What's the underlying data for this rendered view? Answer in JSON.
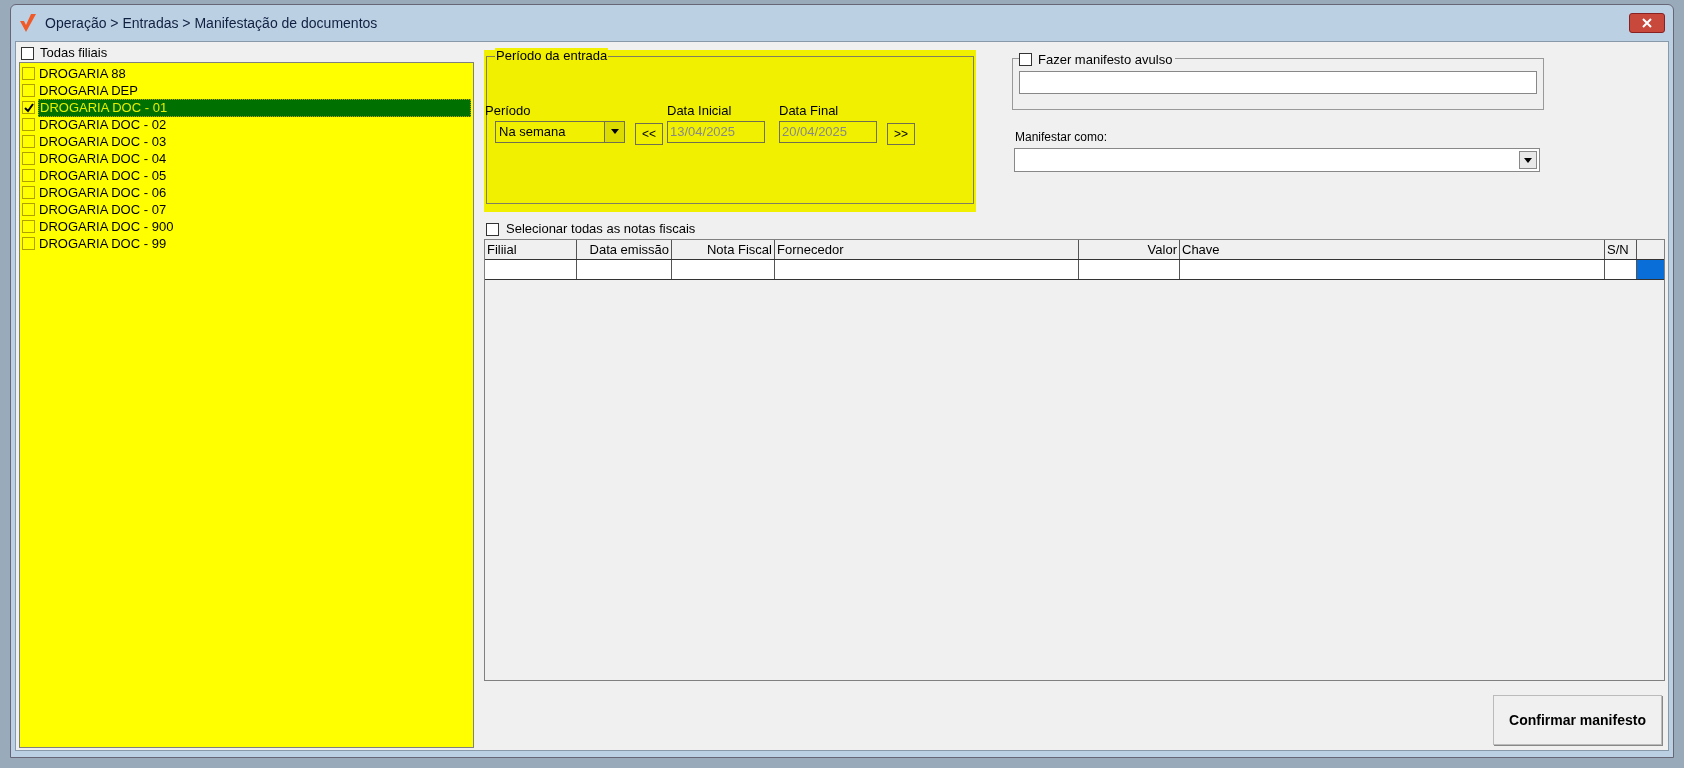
{
  "window": {
    "title": "Operação > Entradas > Manifestação de documentos"
  },
  "branches": {
    "all": {
      "label": "Todas filiais",
      "checked": false
    },
    "items": [
      {
        "label": "DROGARIA 88",
        "checked": false,
        "selected": false
      },
      {
        "label": "DROGARIA DEP",
        "checked": false,
        "selected": false
      },
      {
        "label": "DROGARIA DOC - 01",
        "checked": true,
        "selected": true
      },
      {
        "label": "DROGARIA DOC - 02",
        "checked": false,
        "selected": false
      },
      {
        "label": "DROGARIA DOC - 03",
        "checked": false,
        "selected": false
      },
      {
        "label": "DROGARIA DOC - 04",
        "checked": false,
        "selected": false
      },
      {
        "label": "DROGARIA DOC - 05",
        "checked": false,
        "selected": false
      },
      {
        "label": "DROGARIA DOC - 06",
        "checked": false,
        "selected": false
      },
      {
        "label": "DROGARIA DOC - 07",
        "checked": false,
        "selected": false
      },
      {
        "label": "DROGARIA DOC - 900",
        "checked": false,
        "selected": false
      },
      {
        "label": "DROGARIA DOC - 99",
        "checked": false,
        "selected": false
      }
    ]
  },
  "period": {
    "title": "Período da entrada",
    "period_label": "Período",
    "period_value": "Na semana",
    "prev_button": "<<",
    "start_label": "Data Inicial",
    "start_value": "13/04/2025",
    "end_label": "Data Final",
    "end_value": "20/04/2025",
    "next_button": ">>"
  },
  "avulso": {
    "label": "Fazer manifesto avulso",
    "checked": false
  },
  "manifest_as": {
    "label": "Manifestar como:"
  },
  "select_all": {
    "label": "Selecionar todas as notas fiscais",
    "checked": false
  },
  "table": {
    "columns": [
      "Filiial",
      "Data emissão",
      "Nota Fiscal",
      "Fornecedor",
      "Valor",
      "Chave",
      "S/N"
    ]
  },
  "confirm_button": "Confirmar manifesto"
}
